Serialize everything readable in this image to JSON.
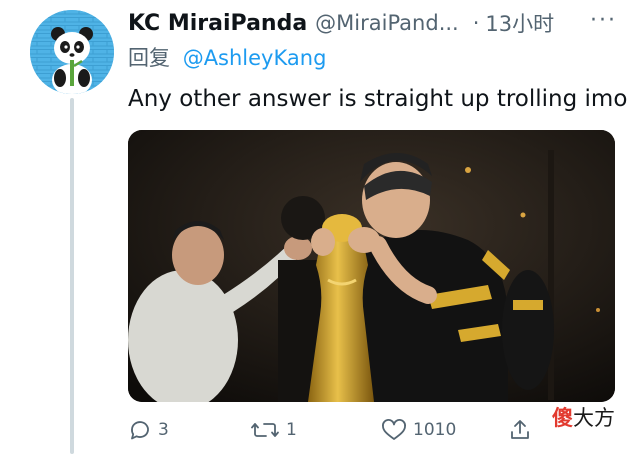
{
  "tweet": {
    "display_name": "KC MiraiPanda",
    "handle": "@MiraiPand...",
    "separator": "·",
    "time": "13小时",
    "more": "···",
    "reply_prefix": "回复",
    "reply_to": "@AshleyKang",
    "text": "Any other answer is straight up trolling imo"
  },
  "actions": {
    "replies": "3",
    "retweets": "1",
    "likes": "1010"
  },
  "watermark": {
    "first_char": "傻",
    "rest": "大方"
  },
  "colors": {
    "avatar_bg": "#4fb3e6",
    "link": "#1d9bf0",
    "muted": "#536471"
  }
}
